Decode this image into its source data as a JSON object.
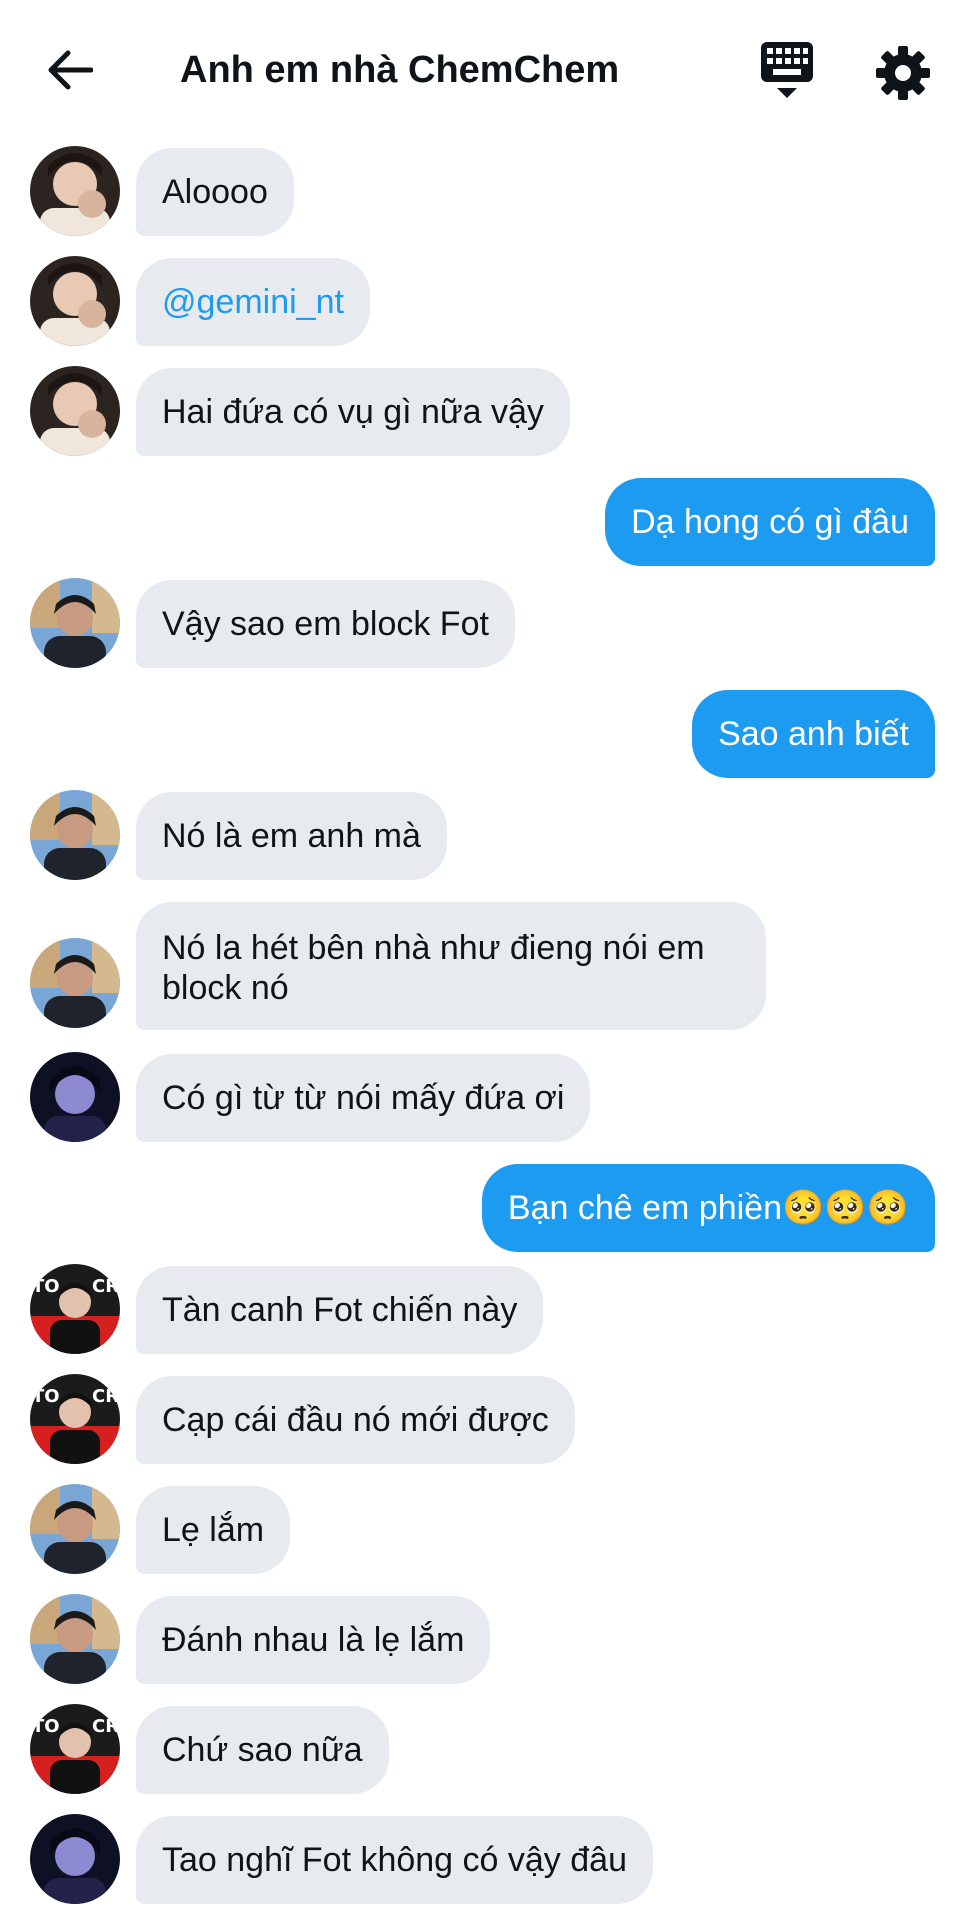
{
  "header": {
    "title": "Anh em nhà ChemChem",
    "back_icon": "arrow-left-icon",
    "keyboard_icon": "keyboard-icon",
    "settings_icon": "gear-icon"
  },
  "colors": {
    "incoming_bubble": "#e7ebef",
    "outgoing_bubble": "#1d9bf0",
    "mention": "#1d9bf0",
    "text": "#0f1419"
  },
  "messages": [
    {
      "side": "in",
      "avatar": "avatar-a",
      "text": "Aloooo"
    },
    {
      "side": "in",
      "avatar": "avatar-a",
      "text": "@gemini_nt"
    },
    {
      "side": "in",
      "avatar": "avatar-a",
      "text": "Hai đứa có vụ gì nữa vậy"
    },
    {
      "side": "out",
      "text": "Dạ hong có gì đâu"
    },
    {
      "side": "in",
      "avatar": "avatar-b",
      "text": "Vậy sao em block Fot"
    },
    {
      "side": "out",
      "text": "Sao anh biết"
    },
    {
      "side": "in",
      "avatar": "avatar-b",
      "text": "Nó là em anh mà"
    },
    {
      "side": "in",
      "avatar": "avatar-b",
      "text": "Nó la hét bên nhà như đieng nói em block nó"
    },
    {
      "side": "in",
      "avatar": "avatar-c",
      "text": "Có gì từ từ nói mấy đứa ơi"
    },
    {
      "side": "out",
      "text": "Bạn chê em phiền🥺🥺🥺"
    },
    {
      "side": "in",
      "avatar": "avatar-d",
      "text": "Tàn canh Fot chiến này"
    },
    {
      "side": "in",
      "avatar": "avatar-d",
      "text": "Cạp cái đầu nó mới được"
    },
    {
      "side": "in",
      "avatar": "avatar-b",
      "text": "Lẹ lắm"
    },
    {
      "side": "in",
      "avatar": "avatar-b",
      "text": "Đánh nhau là lẹ lắm"
    },
    {
      "side": "in",
      "avatar": "avatar-d",
      "text": "Chứ sao nữa"
    },
    {
      "side": "in",
      "avatar": "avatar-c",
      "text": "Tao nghĩ Fot không có vậy đâu"
    }
  ]
}
